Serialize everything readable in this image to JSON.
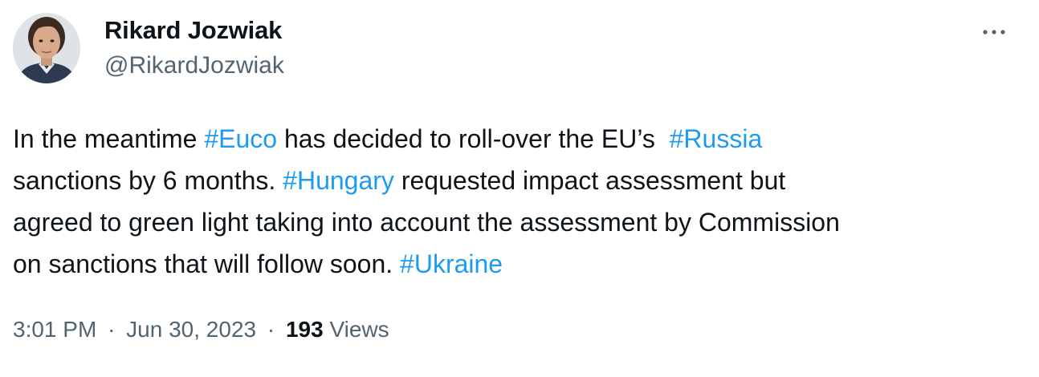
{
  "author": {
    "display_name": "Rikard Jozwiak",
    "handle": "@RikardJozwiak"
  },
  "icons": {
    "more": "more-horizontal-icon",
    "avatar": "profile-photo"
  },
  "tweet": {
    "lines": [
      [
        {
          "text": "In the meantime ",
          "type": "text"
        },
        {
          "text": "#Euco",
          "type": "hashtag"
        },
        {
          "text": " has decided to roll-over the EU’s  ",
          "type": "text"
        },
        {
          "text": "#Russia",
          "type": "hashtag"
        }
      ],
      [
        {
          "text": "sanctions by 6 months. ",
          "type": "text"
        },
        {
          "text": "#Hungary",
          "type": "hashtag"
        },
        {
          "text": " requested impact assessment but",
          "type": "text"
        }
      ],
      [
        {
          "text": "agreed to green light taking into account the assessment by Commission",
          "type": "text"
        }
      ],
      [
        {
          "text": "on sanctions that will follow soon. ",
          "type": "text"
        },
        {
          "text": "#Ukraine",
          "type": "hashtag"
        }
      ]
    ]
  },
  "meta": {
    "time": "3:01 PM",
    "separator": "·",
    "date": "Jun 30, 2023",
    "views_count": "193",
    "views_label": "Views"
  },
  "colors": {
    "text": "#0f1419",
    "secondary": "#536471",
    "link": "#1d9bf0",
    "background": "#ffffff"
  }
}
